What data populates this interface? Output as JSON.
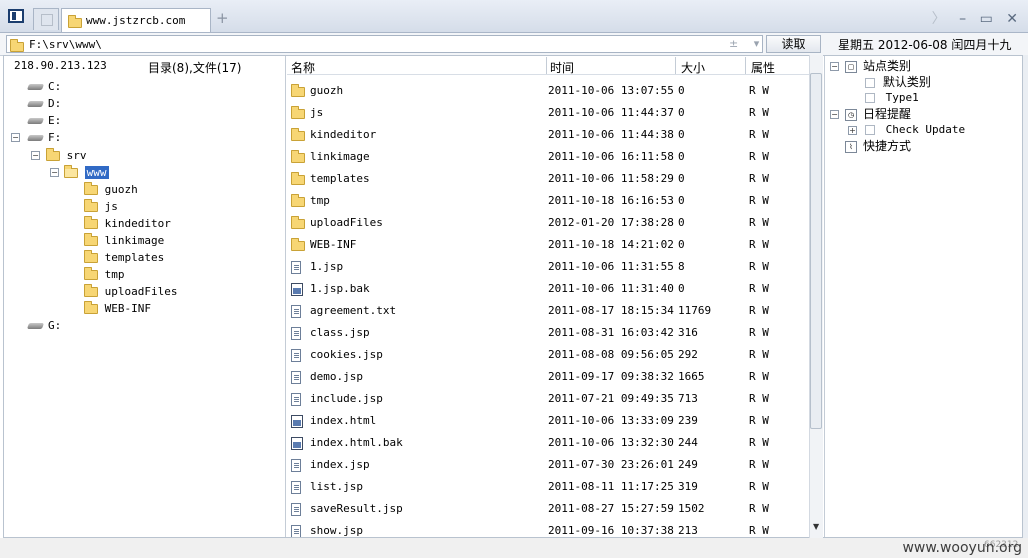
{
  "browser": {
    "tab_title": "www.jstzrcb.com",
    "new_tab": "+",
    "window_controls": [
      "〉",
      "–",
      "▭",
      "✕"
    ]
  },
  "address_bar": {
    "path": "F:\\srv\\www\\",
    "scroll_arrows": "± ▾",
    "read_button": "读取",
    "date_text": "星期五  2012-06-08  闰四月十九"
  },
  "left_pane": {
    "ip": "218.90.213.123",
    "summary": "目录(8),文件(17)",
    "drives": {
      "c": "C:",
      "d": "D:",
      "e": "E:",
      "f": "F:",
      "g": "G:"
    },
    "srv": "srv",
    "www": "www",
    "www_children": [
      "guozh",
      "js",
      "kindeditor",
      "linkimage",
      "templates",
      "tmp",
      "uploadFiles",
      "WEB-INF"
    ]
  },
  "file_list": {
    "headers": {
      "name": "名称",
      "time": "时间",
      "size": "大小",
      "attr": "属性"
    },
    "rows": [
      {
        "name": "guozh",
        "time": "2011-10-06 13:07:55",
        "size": "0",
        "attr": "R W",
        "kind": "folder"
      },
      {
        "name": "js",
        "time": "2011-10-06 11:44:37",
        "size": "0",
        "attr": "R W",
        "kind": "folder"
      },
      {
        "name": "kindeditor",
        "time": "2011-10-06 11:44:38",
        "size": "0",
        "attr": "R W",
        "kind": "folder"
      },
      {
        "name": "linkimage",
        "time": "2011-10-06 16:11:58",
        "size": "0",
        "attr": "R W",
        "kind": "folder"
      },
      {
        "name": "templates",
        "time": "2011-10-06 11:58:29",
        "size": "0",
        "attr": "R W",
        "kind": "folder"
      },
      {
        "name": "tmp",
        "time": "2011-10-18 16:16:53",
        "size": "0",
        "attr": "R W",
        "kind": "folder"
      },
      {
        "name": "uploadFiles",
        "time": "2012-01-20 17:38:28",
        "size": "0",
        "attr": "R W",
        "kind": "folder"
      },
      {
        "name": "WEB-INF",
        "time": "2011-10-18 14:21:02",
        "size": "0",
        "attr": "R W",
        "kind": "folder"
      },
      {
        "name": "1.jsp",
        "time": "2011-10-06 11:31:55",
        "size": "8",
        "attr": "R W",
        "kind": "doc"
      },
      {
        "name": "1.jsp.bak",
        "time": "2011-10-06 11:31:40",
        "size": "0",
        "attr": "R W",
        "kind": "html"
      },
      {
        "name": "agreement.txt",
        "time": "2011-08-17 18:15:34",
        "size": "11769",
        "attr": "R W",
        "kind": "doc"
      },
      {
        "name": "class.jsp",
        "time": "2011-08-31 16:03:42",
        "size": "316",
        "attr": "R W",
        "kind": "doc"
      },
      {
        "name": "cookies.jsp",
        "time": "2011-08-08 09:56:05",
        "size": "292",
        "attr": "R W",
        "kind": "doc"
      },
      {
        "name": "demo.jsp",
        "time": "2011-09-17 09:38:32",
        "size": "1665",
        "attr": "R W",
        "kind": "doc"
      },
      {
        "name": "include.jsp",
        "time": "2011-07-21 09:49:35",
        "size": "713",
        "attr": "R W",
        "kind": "doc"
      },
      {
        "name": "index.html",
        "time": "2011-10-06 13:33:09",
        "size": "239",
        "attr": "R W",
        "kind": "html"
      },
      {
        "name": "index.html.bak",
        "time": "2011-10-06 13:32:30",
        "size": "244",
        "attr": "R W",
        "kind": "html"
      },
      {
        "name": "index.jsp",
        "time": "2011-07-30 23:26:01",
        "size": "249",
        "attr": "R W",
        "kind": "doc"
      },
      {
        "name": "list.jsp",
        "time": "2011-08-11 11:17:25",
        "size": "319",
        "attr": "R W",
        "kind": "doc"
      },
      {
        "name": "saveResult.jsp",
        "time": "2011-08-27 15:27:59",
        "size": "1502",
        "attr": "R W",
        "kind": "doc"
      },
      {
        "name": "show.jsp",
        "time": "2011-09-16 10:37:38",
        "size": "213",
        "attr": "R W",
        "kind": "doc"
      }
    ]
  },
  "right_pane": {
    "site_category": "站点类别",
    "default_category": "默认类别",
    "type1": "Type1",
    "schedule": "日程提醒",
    "check_update": "Check Update",
    "shortcuts": "快捷方式"
  },
  "footer": {
    "watermark": "www.wooyun.org",
    "small_id": "662312"
  }
}
